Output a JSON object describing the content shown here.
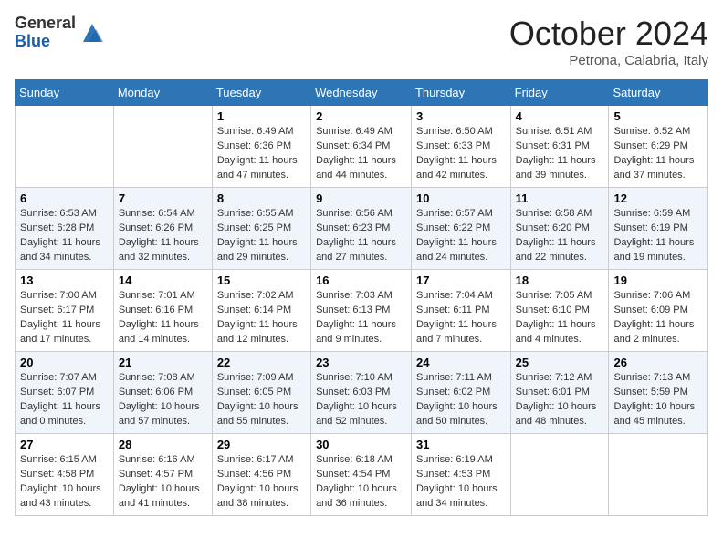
{
  "header": {
    "logo_general": "General",
    "logo_blue": "Blue",
    "month": "October 2024",
    "location": "Petrona, Calabria, Italy"
  },
  "weekdays": [
    "Sunday",
    "Monday",
    "Tuesday",
    "Wednesday",
    "Thursday",
    "Friday",
    "Saturday"
  ],
  "weeks": [
    [
      {
        "day": "",
        "info": ""
      },
      {
        "day": "",
        "info": ""
      },
      {
        "day": "1",
        "info": "Sunrise: 6:49 AM\nSunset: 6:36 PM\nDaylight: 11 hours and 47 minutes."
      },
      {
        "day": "2",
        "info": "Sunrise: 6:49 AM\nSunset: 6:34 PM\nDaylight: 11 hours and 44 minutes."
      },
      {
        "day": "3",
        "info": "Sunrise: 6:50 AM\nSunset: 6:33 PM\nDaylight: 11 hours and 42 minutes."
      },
      {
        "day": "4",
        "info": "Sunrise: 6:51 AM\nSunset: 6:31 PM\nDaylight: 11 hours and 39 minutes."
      },
      {
        "day": "5",
        "info": "Sunrise: 6:52 AM\nSunset: 6:29 PM\nDaylight: 11 hours and 37 minutes."
      }
    ],
    [
      {
        "day": "6",
        "info": "Sunrise: 6:53 AM\nSunset: 6:28 PM\nDaylight: 11 hours and 34 minutes."
      },
      {
        "day": "7",
        "info": "Sunrise: 6:54 AM\nSunset: 6:26 PM\nDaylight: 11 hours and 32 minutes."
      },
      {
        "day": "8",
        "info": "Sunrise: 6:55 AM\nSunset: 6:25 PM\nDaylight: 11 hours and 29 minutes."
      },
      {
        "day": "9",
        "info": "Sunrise: 6:56 AM\nSunset: 6:23 PM\nDaylight: 11 hours and 27 minutes."
      },
      {
        "day": "10",
        "info": "Sunrise: 6:57 AM\nSunset: 6:22 PM\nDaylight: 11 hours and 24 minutes."
      },
      {
        "day": "11",
        "info": "Sunrise: 6:58 AM\nSunset: 6:20 PM\nDaylight: 11 hours and 22 minutes."
      },
      {
        "day": "12",
        "info": "Sunrise: 6:59 AM\nSunset: 6:19 PM\nDaylight: 11 hours and 19 minutes."
      }
    ],
    [
      {
        "day": "13",
        "info": "Sunrise: 7:00 AM\nSunset: 6:17 PM\nDaylight: 11 hours and 17 minutes."
      },
      {
        "day": "14",
        "info": "Sunrise: 7:01 AM\nSunset: 6:16 PM\nDaylight: 11 hours and 14 minutes."
      },
      {
        "day": "15",
        "info": "Sunrise: 7:02 AM\nSunset: 6:14 PM\nDaylight: 11 hours and 12 minutes."
      },
      {
        "day": "16",
        "info": "Sunrise: 7:03 AM\nSunset: 6:13 PM\nDaylight: 11 hours and 9 minutes."
      },
      {
        "day": "17",
        "info": "Sunrise: 7:04 AM\nSunset: 6:11 PM\nDaylight: 11 hours and 7 minutes."
      },
      {
        "day": "18",
        "info": "Sunrise: 7:05 AM\nSunset: 6:10 PM\nDaylight: 11 hours and 4 minutes."
      },
      {
        "day": "19",
        "info": "Sunrise: 7:06 AM\nSunset: 6:09 PM\nDaylight: 11 hours and 2 minutes."
      }
    ],
    [
      {
        "day": "20",
        "info": "Sunrise: 7:07 AM\nSunset: 6:07 PM\nDaylight: 11 hours and 0 minutes."
      },
      {
        "day": "21",
        "info": "Sunrise: 7:08 AM\nSunset: 6:06 PM\nDaylight: 10 hours and 57 minutes."
      },
      {
        "day": "22",
        "info": "Sunrise: 7:09 AM\nSunset: 6:05 PM\nDaylight: 10 hours and 55 minutes."
      },
      {
        "day": "23",
        "info": "Sunrise: 7:10 AM\nSunset: 6:03 PM\nDaylight: 10 hours and 52 minutes."
      },
      {
        "day": "24",
        "info": "Sunrise: 7:11 AM\nSunset: 6:02 PM\nDaylight: 10 hours and 50 minutes."
      },
      {
        "day": "25",
        "info": "Sunrise: 7:12 AM\nSunset: 6:01 PM\nDaylight: 10 hours and 48 minutes."
      },
      {
        "day": "26",
        "info": "Sunrise: 7:13 AM\nSunset: 5:59 PM\nDaylight: 10 hours and 45 minutes."
      }
    ],
    [
      {
        "day": "27",
        "info": "Sunrise: 6:15 AM\nSunset: 4:58 PM\nDaylight: 10 hours and 43 minutes."
      },
      {
        "day": "28",
        "info": "Sunrise: 6:16 AM\nSunset: 4:57 PM\nDaylight: 10 hours and 41 minutes."
      },
      {
        "day": "29",
        "info": "Sunrise: 6:17 AM\nSunset: 4:56 PM\nDaylight: 10 hours and 38 minutes."
      },
      {
        "day": "30",
        "info": "Sunrise: 6:18 AM\nSunset: 4:54 PM\nDaylight: 10 hours and 36 minutes."
      },
      {
        "day": "31",
        "info": "Sunrise: 6:19 AM\nSunset: 4:53 PM\nDaylight: 10 hours and 34 minutes."
      },
      {
        "day": "",
        "info": ""
      },
      {
        "day": "",
        "info": ""
      }
    ]
  ]
}
